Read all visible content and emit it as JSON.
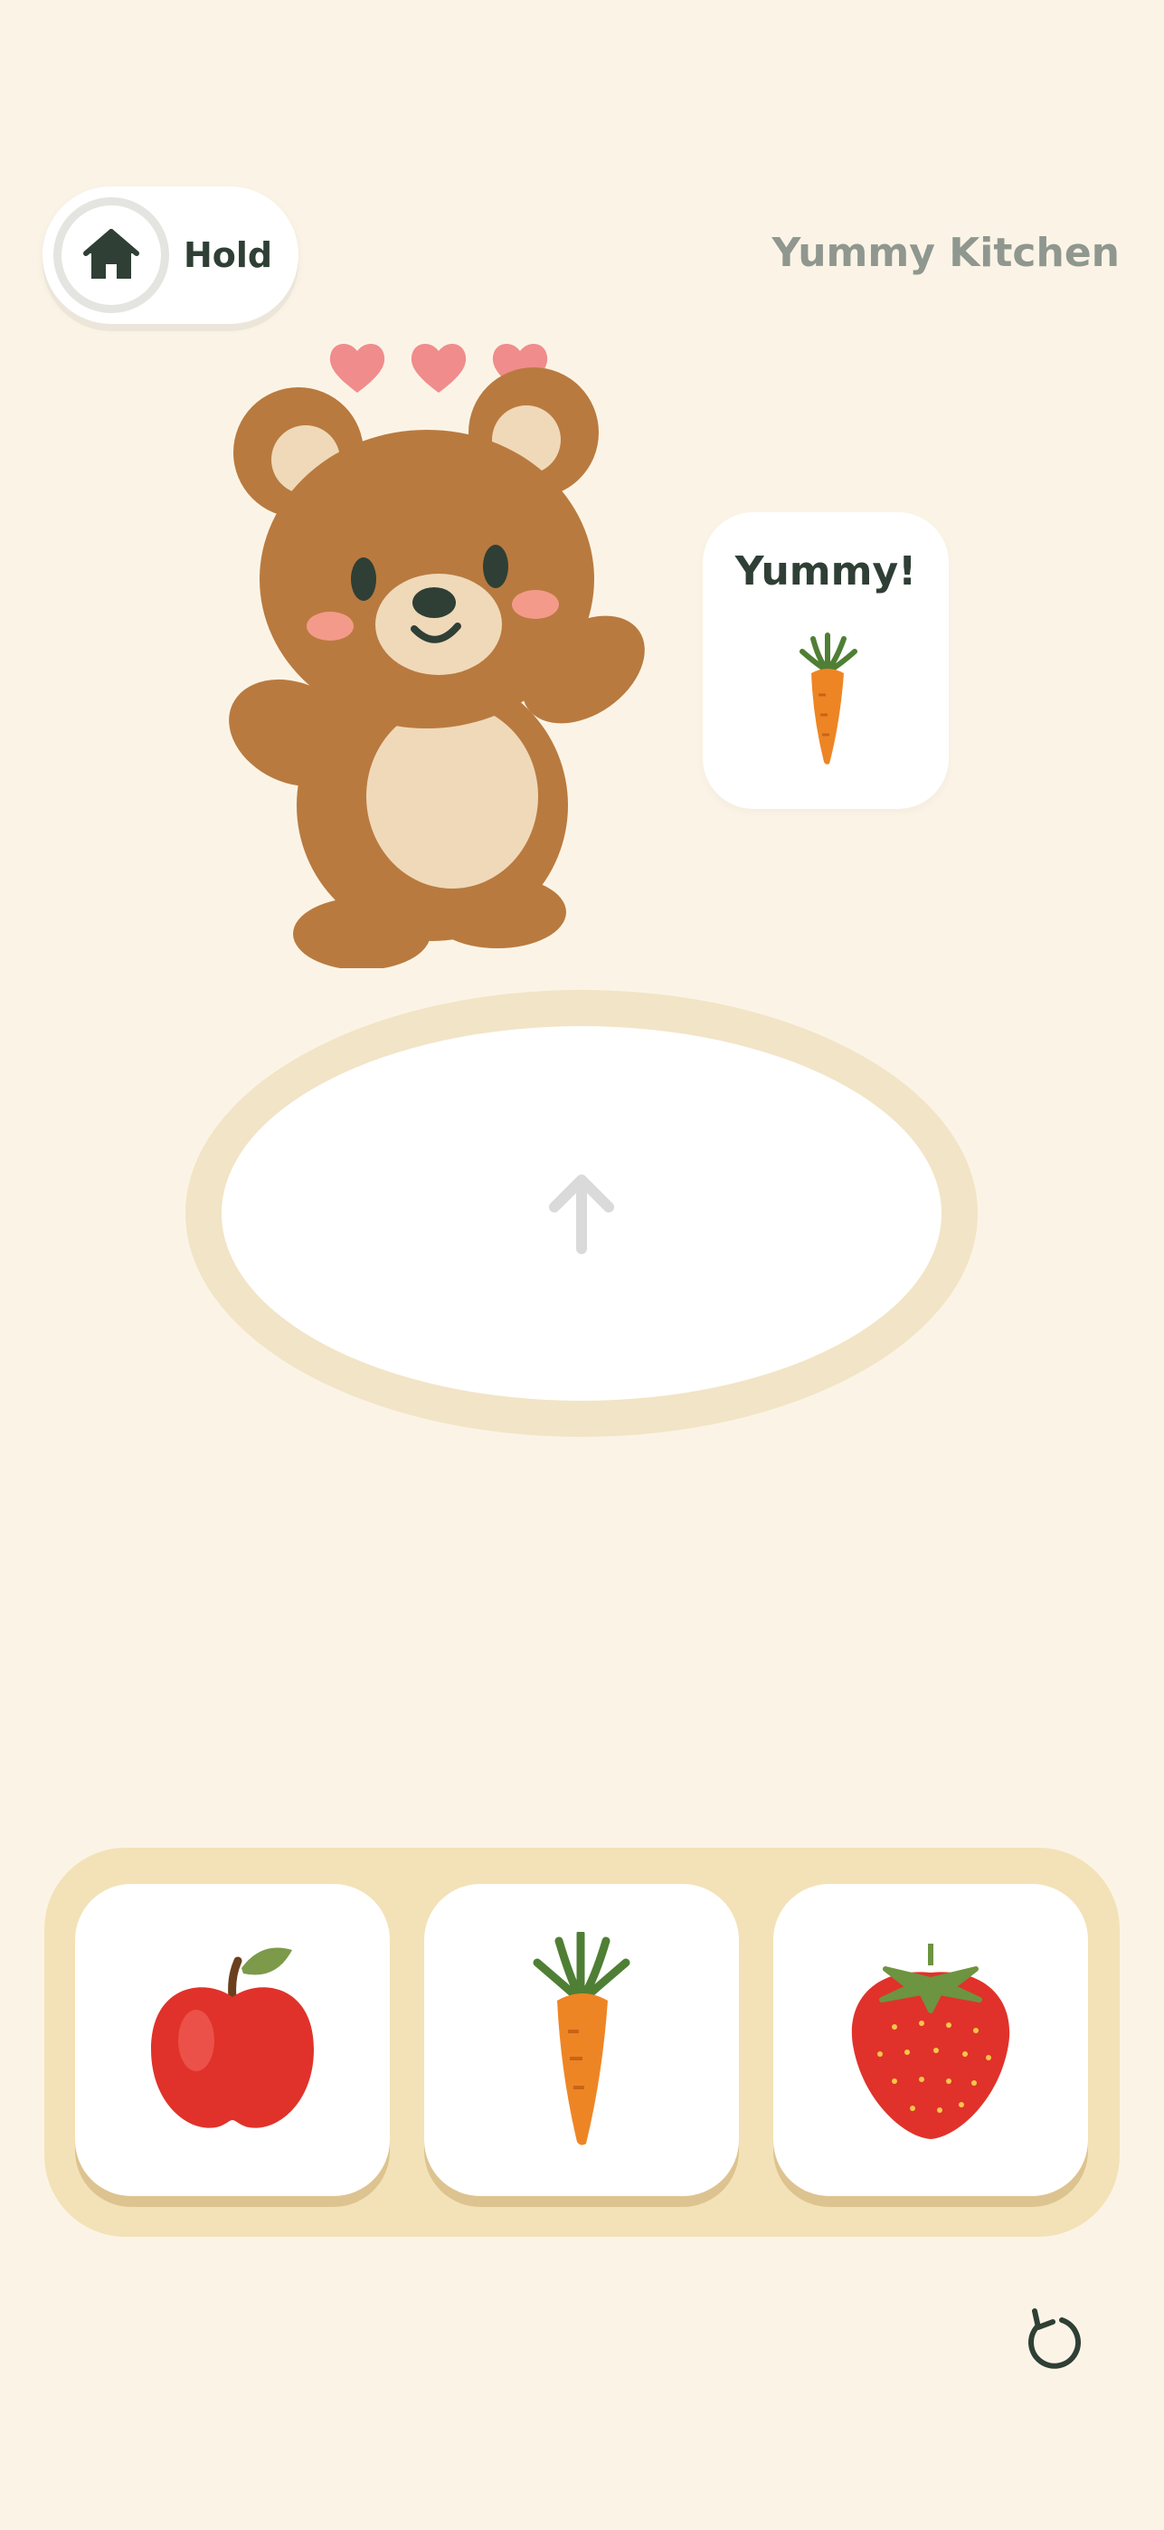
{
  "header": {
    "home_icon": "home-icon",
    "hold_label": "Hold",
    "app_title": "Yummy Kitchen"
  },
  "bear": {
    "hearts": [
      "heart-icon",
      "heart-icon",
      "heart-icon"
    ]
  },
  "speech_bubble": {
    "text": "Yummy!",
    "food_icon": "carrot-icon"
  },
  "plate": {
    "icon": "arrow-up-icon"
  },
  "food_tray": {
    "items": [
      {
        "name": "apple",
        "icon": "apple-icon"
      },
      {
        "name": "carrot",
        "icon": "carrot-icon"
      },
      {
        "name": "strawberry",
        "icon": "strawberry-icon"
      }
    ]
  },
  "footer": {
    "reset_icon": "reset-icon"
  },
  "colors": {
    "background": "#fbf4e6",
    "accent_dark": "#2f3f35",
    "heart_pink": "#f08c8c",
    "bear_brown": "#b97a3f",
    "tray": "#f3e2b7"
  }
}
